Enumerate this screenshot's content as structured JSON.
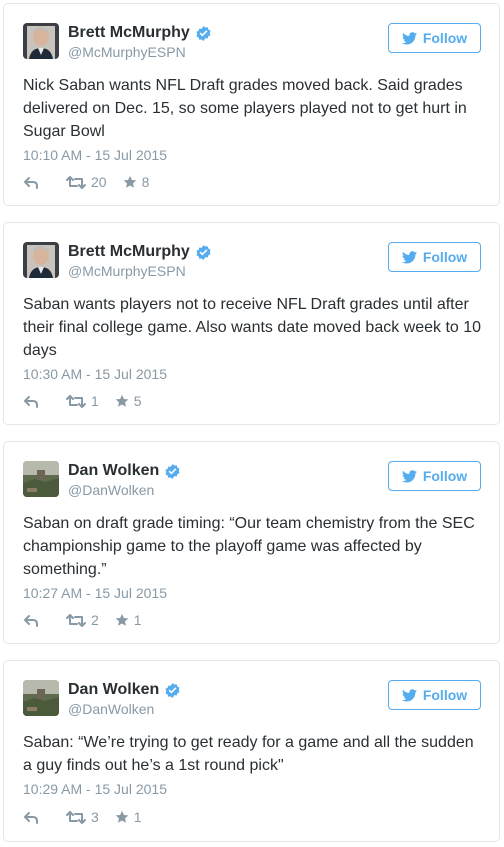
{
  "colors": {
    "accent": "#55acee",
    "verified": "#55acee",
    "text": "#292f33",
    "muted": "#8899a6",
    "border": "#e1e8ed"
  },
  "icons": {
    "verified": "verified-badge-icon",
    "follow": "twitter-bird-icon",
    "reply": "reply-icon",
    "retweet": "retweet-icon",
    "favorite": "star-icon"
  },
  "tweets": [
    {
      "display_name": "Brett McMurphy",
      "screen_name": "@McMurphyESPN",
      "follow_label": "Follow",
      "text": "Nick Saban wants NFL Draft grades moved back. Said grades delivered on Dec. 15, so some players played not to get hurt in Sugar Bowl",
      "timestamp": "10:10 AM - 15 Jul 2015",
      "retweets": "20",
      "favorites": "8"
    },
    {
      "display_name": "Brett McMurphy",
      "screen_name": "@McMurphyESPN",
      "follow_label": "Follow",
      "text": "Saban wants players not to receive NFL Draft grades until after their final college game. Also wants date moved back week to 10 days",
      "timestamp": "10:30 AM - 15 Jul 2015",
      "retweets": "1",
      "favorites": "5"
    },
    {
      "display_name": "Dan Wolken",
      "screen_name": "@DanWolken",
      "follow_label": "Follow",
      "text": "Saban on draft grade timing: “Our team chemistry from the SEC championship game to the playoff game was affected by something.”",
      "timestamp": "10:27 AM - 15 Jul 2015",
      "retweets": "2",
      "favorites": "1"
    },
    {
      "display_name": "Dan Wolken",
      "screen_name": "@DanWolken",
      "follow_label": "Follow",
      "text": "Saban: “We’re trying to get ready for a game and all the sudden a guy finds out he’s a 1st round pick\"",
      "timestamp": "10:29 AM - 15 Jul 2015",
      "retweets": "3",
      "favorites": "1"
    }
  ]
}
